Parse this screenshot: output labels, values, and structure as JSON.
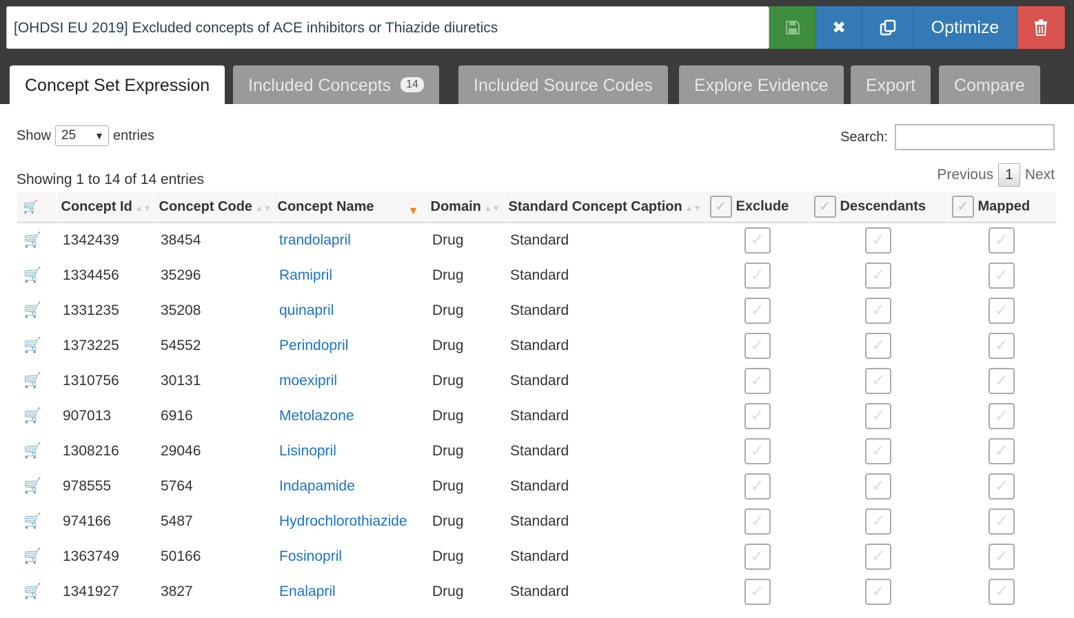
{
  "header": {
    "title_value": "[OHDSI EU 2019] Excluded concepts of ACE inhibitors or Thiazide diuretics",
    "optimize_label": "Optimize"
  },
  "tabs": [
    {
      "label": "Concept Set Expression"
    },
    {
      "label": "Included Concepts",
      "badge": "14"
    },
    {
      "label": "Included Source Codes"
    },
    {
      "label": "Explore Evidence"
    },
    {
      "label": "Export"
    },
    {
      "label": "Compare"
    }
  ],
  "controls": {
    "show_label": "Show",
    "page_size": "25",
    "entries_label": "entries",
    "search_label": "Search:",
    "info": "Showing 1 to 14 of 14 entries",
    "previous": "Previous",
    "page": "1",
    "next": "Next"
  },
  "table": {
    "headers": [
      "Concept Id",
      "Concept Code",
      "Concept Name",
      "Domain",
      "Standard Concept Caption",
      "Exclude",
      "Descendants",
      "Mapped"
    ],
    "rows": [
      {
        "id": "1342439",
        "code": "38454",
        "name": "trandolapril",
        "domain": "Drug",
        "caption": "Standard"
      },
      {
        "id": "1334456",
        "code": "35296",
        "name": "Ramipril",
        "domain": "Drug",
        "caption": "Standard"
      },
      {
        "id": "1331235",
        "code": "35208",
        "name": "quinapril",
        "domain": "Drug",
        "caption": "Standard"
      },
      {
        "id": "1373225",
        "code": "54552",
        "name": "Perindopril",
        "domain": "Drug",
        "caption": "Standard"
      },
      {
        "id": "1310756",
        "code": "30131",
        "name": "moexipril",
        "domain": "Drug",
        "caption": "Standard"
      },
      {
        "id": "907013",
        "code": "6916",
        "name": "Metolazone",
        "domain": "Drug",
        "caption": "Standard"
      },
      {
        "id": "1308216",
        "code": "29046",
        "name": "Lisinopril",
        "domain": "Drug",
        "caption": "Standard"
      },
      {
        "id": "978555",
        "code": "5764",
        "name": "Indapamide",
        "domain": "Drug",
        "caption": "Standard"
      },
      {
        "id": "974166",
        "code": "5487",
        "name": "Hydrochlorothiazide",
        "domain": "Drug",
        "caption": "Standard"
      },
      {
        "id": "1363749",
        "code": "50166",
        "name": "Fosinopril",
        "domain": "Drug",
        "caption": "Standard"
      },
      {
        "id": "1341927",
        "code": "3827",
        "name": "Enalapril",
        "domain": "Drug",
        "caption": "Standard"
      }
    ]
  },
  "colors": {
    "save": "#3e8c3e",
    "primary": "#337ab7",
    "danger": "#d9534f",
    "link": "#1a73c8",
    "cart": "#f39c12"
  }
}
